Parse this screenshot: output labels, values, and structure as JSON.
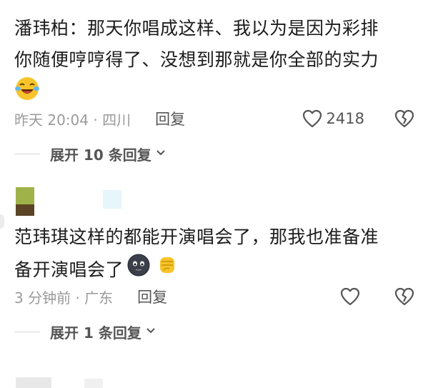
{
  "comments": [
    {
      "text_line1": "潘玮柏：那天你唱成这样、我以为是因为彩排",
      "text_line2": "你随便哼哼得了、没想到那就是你全部的实力",
      "emoji": "laughing-crying-emoji",
      "time_location": "昨天 20:04 · 四川",
      "reply_label": "回复",
      "like_count": "2418",
      "expand_label": "展开 10 条回复"
    },
    {
      "text_line1": "范玮琪这样的都能开演唱会了，那我也准备准",
      "text_line2": "备开演唱会了",
      "emojis": [
        "dark-blob-face-emoji",
        "raised-fist-emoji"
      ],
      "time_location": "3 分钟前 · 广东",
      "reply_label": "回复",
      "like_count": "",
      "expand_label": "展开 1 条回复"
    }
  ],
  "colors": {
    "text": "#1c1c1c",
    "meta": "#9a9a9a",
    "icon": "#555555"
  }
}
